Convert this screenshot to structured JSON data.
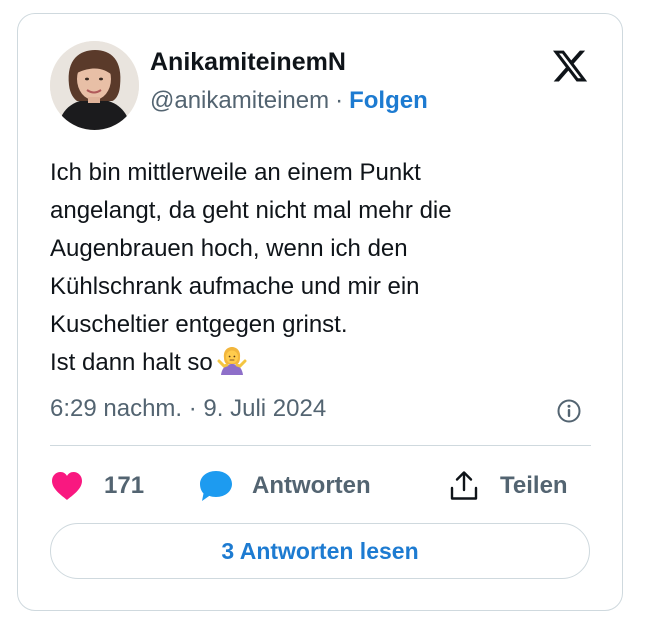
{
  "author": {
    "display_name": "AnikamiteinemN",
    "handle": "@anikamiteinem",
    "separator": "·",
    "follow_label": "Folgen"
  },
  "tweet": {
    "lines": [
      "Ich bin mittlerweile an einem Punkt",
      "angelangt, da geht nicht mal mehr die",
      "Augenbrauen hoch, wenn ich den",
      "Kühlschrank aufmache und mir ein",
      "Kuscheltier entgegen grinst.",
      "Ist dann halt so"
    ],
    "timestamp": "6:29 nachm. · 9. Juli 2024"
  },
  "actions": {
    "like_count": "171",
    "reply_label": "Antworten",
    "share_label": "Teilen"
  },
  "read_replies_label": "3 Antworten lesen",
  "icons": {
    "platform_logo": "x-logo-icon",
    "info": "info-icon",
    "like": "heart-icon",
    "reply": "speech-bubble-icon",
    "share": "share-upload-icon",
    "emoji": "person-shrugging-emoji"
  },
  "colors": {
    "text": "#0f1419",
    "secondary_text": "#536471",
    "link": "#1d7bd1",
    "heart": "#f91880",
    "reply_bubble": "#1d9bf0",
    "border": "#cfd9de"
  }
}
